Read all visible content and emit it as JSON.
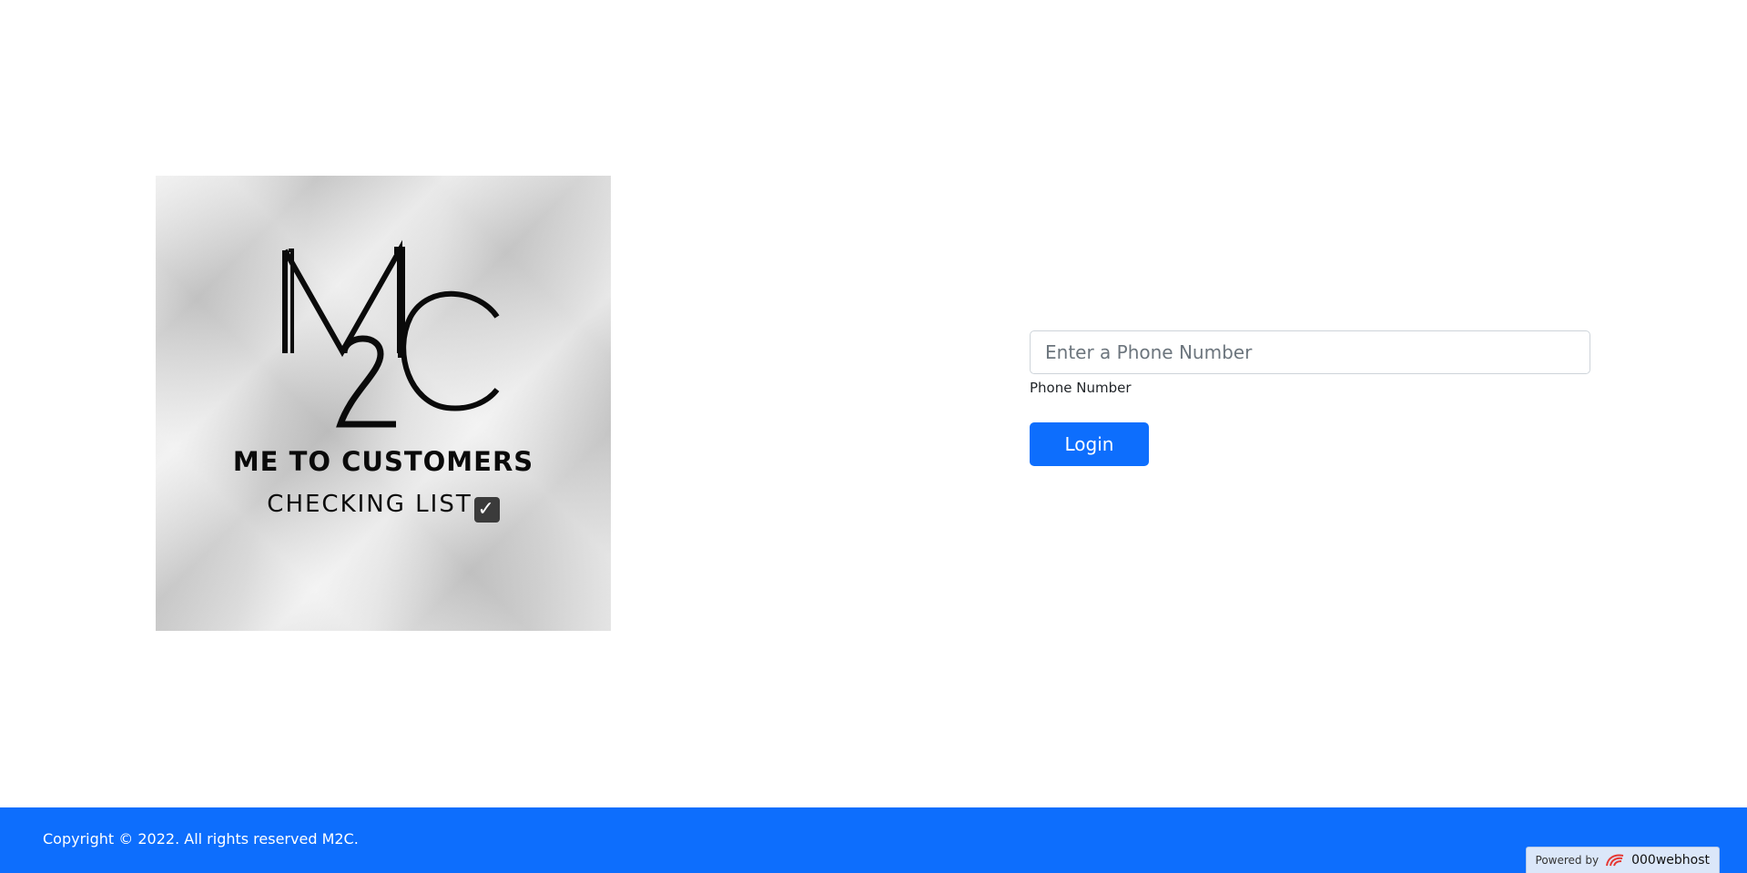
{
  "logo": {
    "mark_text": "M2C",
    "tagline_line1": "ME TO CUSTOMERS",
    "tagline_line2": "CHECKING LIST",
    "check_icon": "check-box-icon"
  },
  "form": {
    "phone_placeholder": "Enter a Phone Number",
    "phone_value": "",
    "phone_label": "Phone Number",
    "login_label": "Login"
  },
  "footer": {
    "copyright": "Copyright © 2022. All rights reserved M2C.",
    "powered_by": "Powered by",
    "host_name": "000webhost",
    "host_icon": "000webhost-logo-icon"
  },
  "colors": {
    "primary": "#0d6efd",
    "badge_bg": "#dbe7f9",
    "host_logo": "#e53935"
  }
}
